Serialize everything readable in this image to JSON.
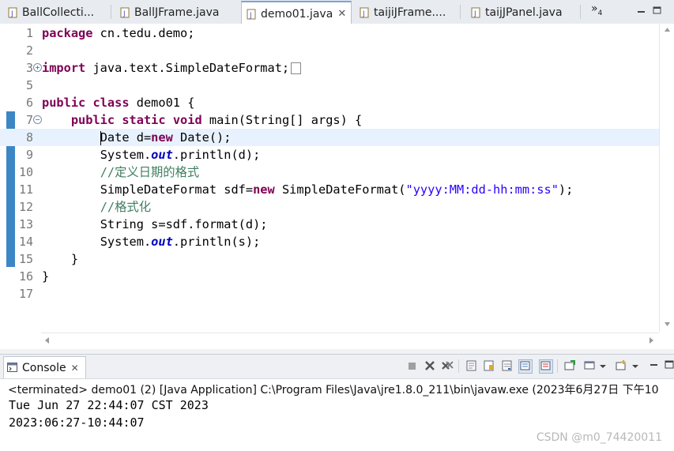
{
  "editor_tabs": [
    {
      "label": "BallCollecti...",
      "active": false
    },
    {
      "label": "BallJFrame.java",
      "active": false
    },
    {
      "label": "demo01.java",
      "active": true,
      "close": "✕"
    },
    {
      "label": "taijiJFrame....",
      "active": false
    },
    {
      "label": "taijJPanel.java",
      "active": false
    }
  ],
  "overflow": {
    "label": "»",
    "count": "4"
  },
  "icons": {
    "java_file": "java-file-icon",
    "console": "console-icon",
    "fold": "fold-toggle-icon"
  },
  "colors": {
    "keyword": "#7f0055",
    "string": "#2a00ff",
    "comment": "#3f7f5f",
    "static_field": "#0000c0",
    "quick_diff": "#3d86c6",
    "current_line": "#e8f2fe"
  },
  "code_lines": [
    {
      "n": "1"
    },
    {
      "n": "2"
    },
    {
      "n": "3"
    },
    {
      "n": "5"
    },
    {
      "n": "6"
    },
    {
      "n": "7"
    },
    {
      "n": "8"
    },
    {
      "n": "9"
    },
    {
      "n": "10"
    },
    {
      "n": "11"
    },
    {
      "n": "12"
    },
    {
      "n": "13"
    },
    {
      "n": "14"
    },
    {
      "n": "15"
    },
    {
      "n": "16"
    },
    {
      "n": "17"
    }
  ],
  "code": {
    "l1_kw": "package",
    "l1_rest": " cn.tedu.demo;",
    "l3_kw": "import",
    "l3_rest": " java.text.SimpleDateFormat;",
    "l6_kw1": "public",
    "l6_kw2": "class",
    "l6_rest": " demo01 {",
    "l7_kw1": "public",
    "l7_kw2": "static",
    "l7_kw3": "void",
    "l7_rest": " main(String[] args) {",
    "l8_a": "Date d=",
    "l8_kw": "new",
    "l8_b": " Date();",
    "l9_a": "System.",
    "l9_st": "out",
    "l9_b": ".println(d);",
    "l10_cm": "//定义日期的格式",
    "l11_a": "SimpleDateFormat sdf=",
    "l11_kw": "new",
    "l11_b": " SimpleDateFormat(",
    "l11_str": "\"yyyy:MM:dd-hh:mm:ss\"",
    "l11_c": ");",
    "l12_cm": "//格式化",
    "l13_a": "String s=sdf.format(d);",
    "l14_a": "System.",
    "l14_st": "out",
    "l14_b": ".println(s);",
    "l15": "}",
    "l16": "}"
  },
  "console": {
    "tab_label": "Console",
    "tab_close": "✕",
    "status": "<terminated> demo01 (2) [Java Application] C:\\Program Files\\Java\\jre1.8.0_211\\bin\\javaw.exe (2023年6月27日 下午10",
    "output": [
      "Tue Jun 27 22:44:07 CST 2023",
      "2023:06:27-10:44:07"
    ]
  },
  "watermark": "CSDN @m0_74420011"
}
